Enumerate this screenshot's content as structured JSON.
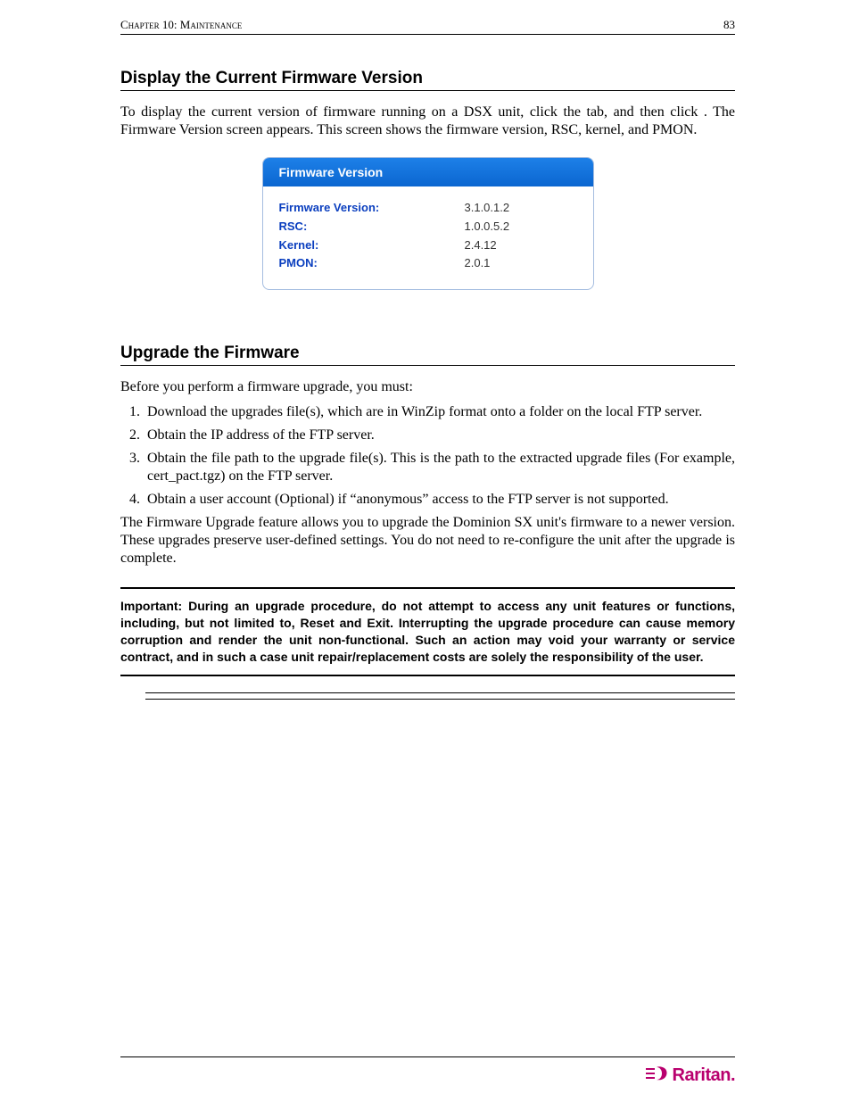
{
  "header": {
    "chapter": "Chapter 10: Maintenance",
    "page_number": "83"
  },
  "section1": {
    "title": "Display the Current Firmware Version",
    "paragraph": "To display the current version of firmware running on a DSX unit, click the                       tab, and then click                                   . The Firmware Version screen appears. This screen shows the firmware version, RSC, kernel, and PMON."
  },
  "fw_card": {
    "header": "Firmware Version",
    "rows": [
      {
        "label": "Firmware Version:",
        "value": "3.1.0.1.2"
      },
      {
        "label": "RSC:",
        "value": "1.0.0.5.2"
      },
      {
        "label": "Kernel:",
        "value": "2.4.12"
      },
      {
        "label": "PMON:",
        "value": "2.0.1"
      }
    ]
  },
  "section2": {
    "title": "Upgrade the Firmware",
    "intro": "Before you perform a firmware upgrade, you must:",
    "steps": [
      "Download the upgrades file(s), which are in WinZip format onto a folder on the local FTP server.",
      "Obtain the IP address of the FTP server.",
      "Obtain the file path to the upgrade file(s). This is the path to the extracted upgrade files (For example, cert_pact.tgz) on the FTP server.",
      "Obtain a user account (Optional) if “anonymous” access to the FTP server is not supported."
    ],
    "after": "The Firmware Upgrade feature allows you to upgrade the Dominion SX unit's firmware to a newer version. These upgrades preserve user-defined settings. You do not need to re-configure the unit after the upgrade is complete.",
    "important": "Important: During an upgrade procedure, do not attempt to access any unit features or functions, including, but not limited to, Reset and Exit. Interrupting the upgrade procedure can cause memory corruption and render the unit non-functional. Such an action may void your warranty or service contract, and in such a case unit repair/replacement costs are solely the responsibility of the user."
  },
  "footer": {
    "brand": "Raritan."
  }
}
